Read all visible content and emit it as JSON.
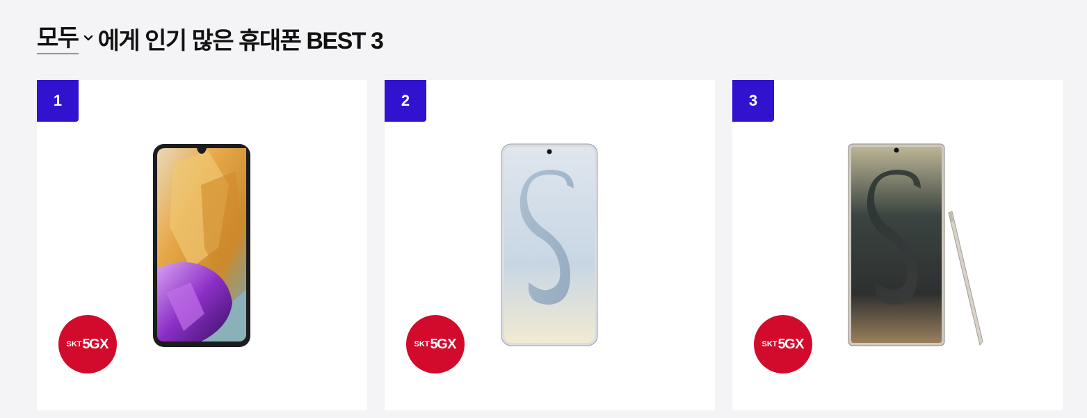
{
  "header": {
    "audience_select": "모두",
    "title_suffix": "에게 인기 많은 휴대폰 BEST 3"
  },
  "products": [
    {
      "rank": "1",
      "badge": {
        "brand": "SKT",
        "mark": "5G",
        "x": "X"
      },
      "image": "galaxy-m15-phone-image"
    },
    {
      "rank": "2",
      "badge": {
        "brand": "SKT",
        "mark": "5G",
        "x": "X"
      },
      "image": "galaxy-s24-phone-image"
    },
    {
      "rank": "3",
      "badge": {
        "brand": "SKT",
        "mark": "5G",
        "x": "X"
      },
      "image": "galaxy-s24-ultra-phone-image"
    }
  ],
  "colors": {
    "rank_badge": "#3113cf",
    "skt_badge": "#d20a2c",
    "background": "#f4f4f6"
  }
}
